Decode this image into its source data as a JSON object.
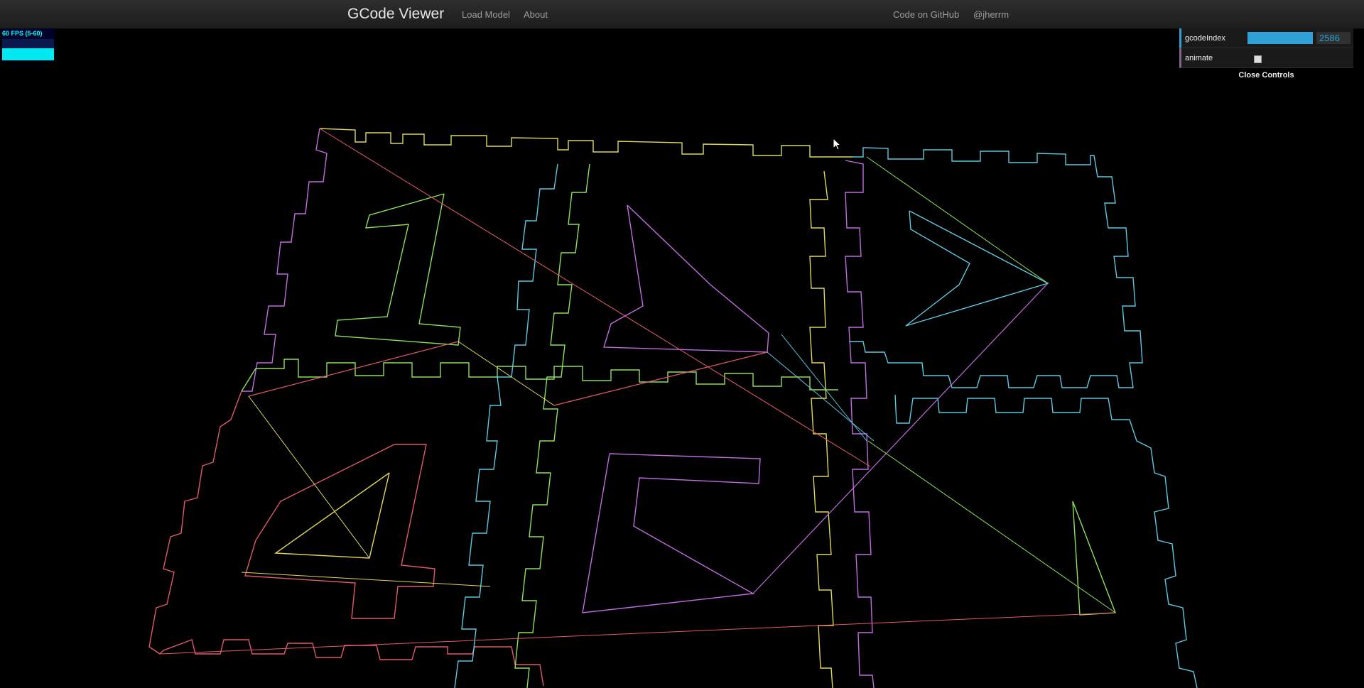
{
  "navbar": {
    "brand": "GCode Viewer",
    "links": [
      "Load Model",
      "About"
    ],
    "right_links": [
      "Code on GitHub",
      "@jherrm"
    ]
  },
  "stats": {
    "fps_text": "60 FPS (5-60)"
  },
  "controls": {
    "gcode_index_label": "gcodeIndex",
    "gcode_index_value": "2586",
    "gcode_index_fill": 1.0,
    "animate_label": "animate",
    "animate_checked": false,
    "close_label": "Close Controls"
  },
  "colors": {
    "navbar_bg": "#222222",
    "slider_fill": "#2fa1d6",
    "fps_text": "#00ffff",
    "background": "#000000",
    "path_colors": [
      "#e05a6a",
      "#5ec8e0",
      "#c06de0",
      "#8ee05a",
      "#e0d85a"
    ]
  },
  "icons": {
    "cursor": "mouse-pointer-icon"
  }
}
